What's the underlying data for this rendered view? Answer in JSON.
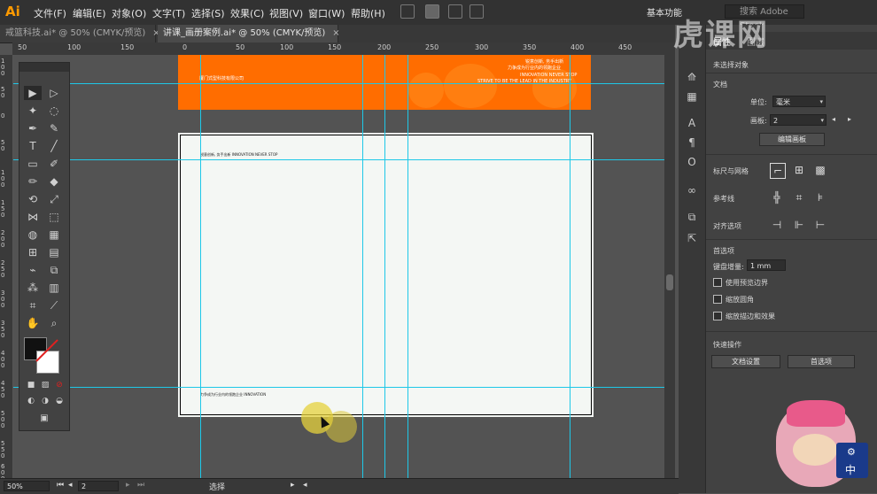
{
  "app": {
    "logo": "Ai",
    "menus": [
      "文件(F)",
      "编辑(E)",
      "对象(O)",
      "文字(T)",
      "选择(S)",
      "效果(C)",
      "视图(V)",
      "窗口(W)",
      "帮助(H)"
    ],
    "workspace": "基本功能",
    "stock_search_placeholder": "搜索 Adobe Stock"
  },
  "tabs": [
    {
      "label": "戒篮科技.ai* @ 50% (CMYK/预览)",
      "close": "×",
      "active": false
    },
    {
      "label": "讲课_画册案例.ai* @ 50% (CMYK/预览)",
      "close": "×",
      "active": true
    }
  ],
  "ruler_top": [
    "50",
    "100",
    "150",
    "0",
    "50",
    "100",
    "150",
    "200",
    "250",
    "300",
    "350",
    "400",
    "450"
  ],
  "ruler_left": [
    "100",
    "50",
    "0",
    "50",
    "100",
    "150",
    "200",
    "250",
    "300",
    "350",
    "400",
    "450",
    "500",
    "550",
    "600"
  ],
  "canvas": {
    "orange_board": {
      "company_left": "厦门式型科技有限公司",
      "right_line1": "锐意创新, 务手出新",
      "right_line2": "力争成为行业内的领跑企业",
      "right_line3": "INNOVATION NEVER STOP",
      "right_line4": "STRIVE TO BE THE LEAD IN THE INDUSTRY"
    },
    "white_board": {
      "top_text": "锐意创新, 务手出新     INNOVATION NEVER STOP",
      "bottom_text": "力争成为行业内的领跑企业 INNOVATION"
    },
    "colors": {
      "orange": "#ff6d00",
      "guide": "#1ec8e8",
      "artboard": "#f4f7f4"
    }
  },
  "properties": {
    "tabs": [
      "属性",
      "图层"
    ],
    "no_selection": "未选择对象",
    "document_label": "文档",
    "units_label": "单位:",
    "units_value": "毫米",
    "artboard_label": "画板:",
    "artboard_value": "2",
    "edit_artboards": "编辑画板",
    "rulers_grids": "标尺与网格",
    "guides": "参考线",
    "snap_options": "对齐选项",
    "preferences": "首选项",
    "keyboard_increment_label": "键盘增量:",
    "keyboard_increment_value": "1 mm",
    "checkboxes": [
      "使用预览边界",
      "缩放圆角",
      "缩放描边和效果"
    ],
    "quick_actions": "快速操作",
    "doc_setup_button": "文档设置",
    "preferences_button": "首选项"
  },
  "status": {
    "zoom": "50%",
    "artboard_number": "2",
    "tool_name": "选择"
  },
  "watermark": "虎课网"
}
